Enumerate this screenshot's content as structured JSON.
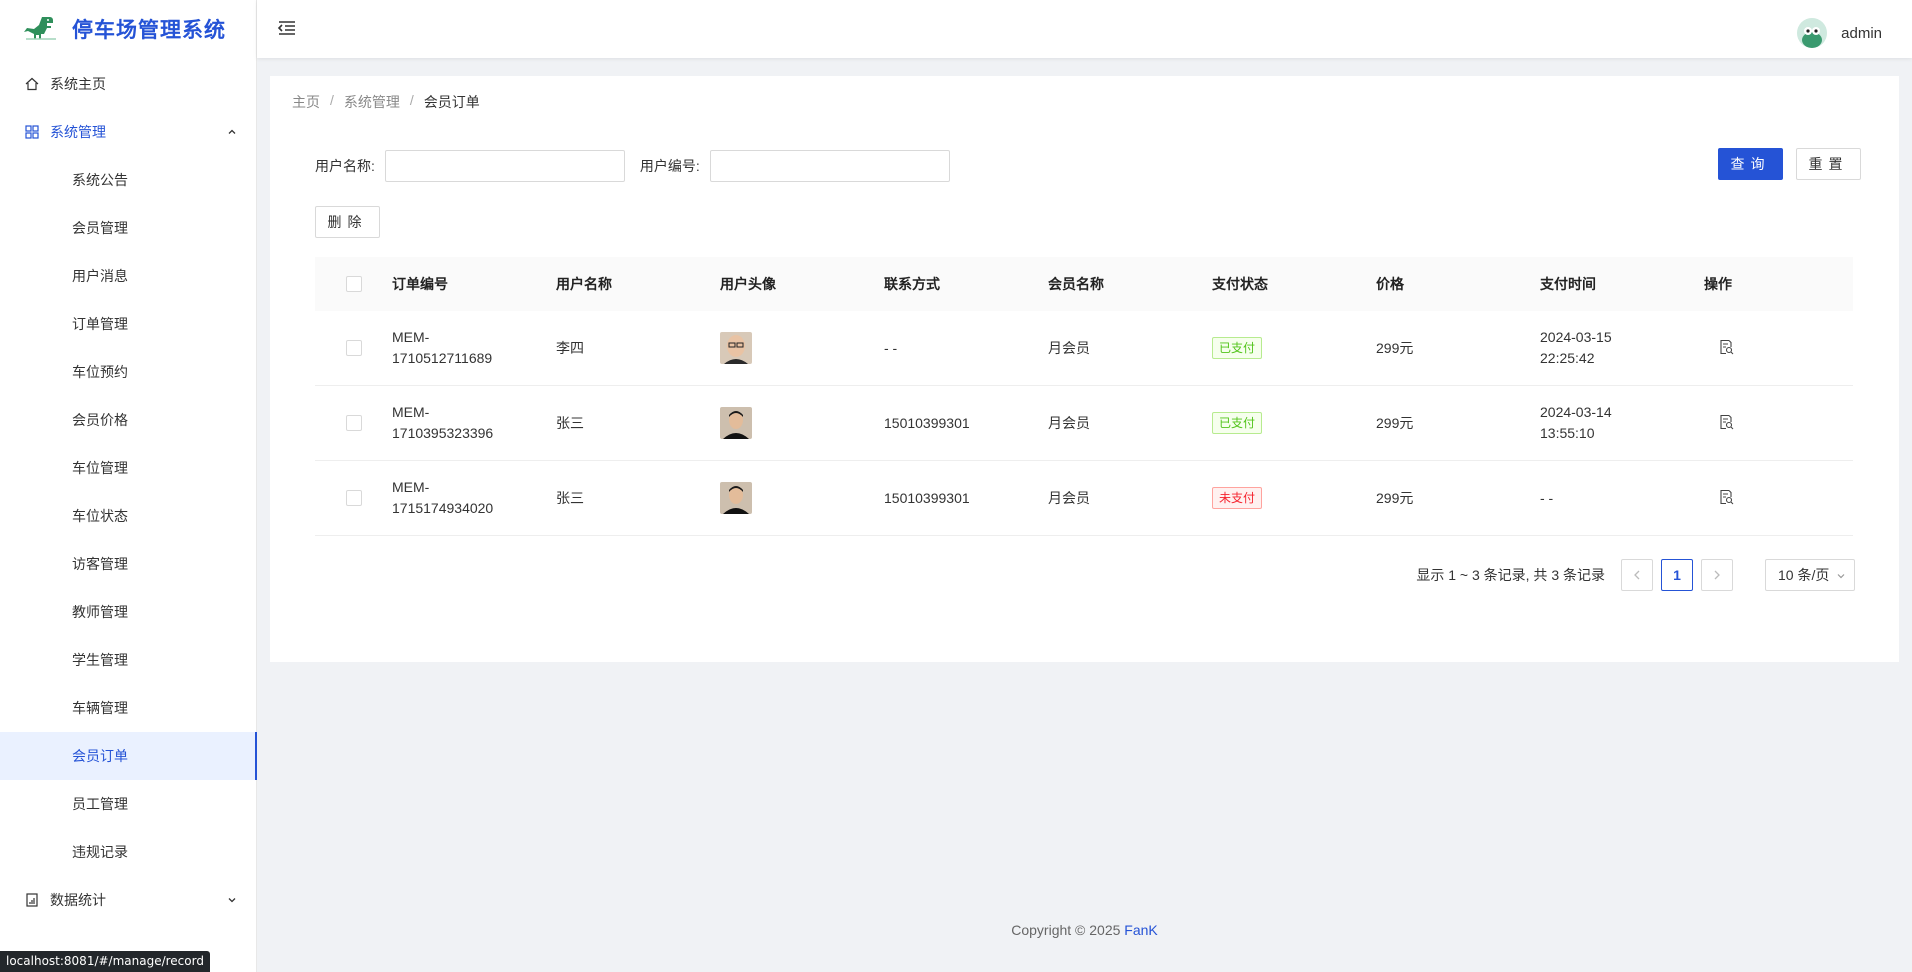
{
  "app": {
    "title": "停车场管理系统"
  },
  "sidebar": {
    "home": "系统主页",
    "system_group": "系统管理",
    "sub_items": [
      "系统公告",
      "会员管理",
      "用户消息",
      "订单管理",
      "车位预约",
      "会员价格",
      "车位管理",
      "车位状态",
      "访客管理",
      "教师管理",
      "学生管理",
      "车辆管理",
      "会员订单",
      "员工管理",
      "违规记录"
    ],
    "active_item": "会员订单",
    "stats_group": "数据统计"
  },
  "status_bar": {
    "url": "localhost:8081/#/manage/record"
  },
  "header": {
    "user_name": "admin"
  },
  "breadcrumb": {
    "home": "主页",
    "parent": "系统管理",
    "current": "会员订单"
  },
  "search": {
    "username_label": "用户名称:",
    "userno_label": "用户编号:",
    "username_value": "",
    "userno_value": "",
    "query_label": "查询",
    "reset_label": "重置"
  },
  "toolbar": {
    "delete_label": "删除"
  },
  "table": {
    "columns": [
      "订单编号",
      "用户名称",
      "用户头像",
      "联系方式",
      "会员名称",
      "支付状态",
      "价格",
      "支付时间",
      "操作"
    ],
    "rows": [
      {
        "order_no_1": "MEM-",
        "order_no_2": "1710512711689",
        "user_name": "李四",
        "contact": "- -",
        "member_name": "月会员",
        "pay_status": "已支付",
        "price": "299元",
        "pay_time_1": "2024-03-15",
        "pay_time_2": "22:25:42"
      },
      {
        "order_no_1": "MEM-",
        "order_no_2": "1710395323396",
        "user_name": "张三",
        "contact": "15010399301",
        "member_name": "月会员",
        "pay_status": "已支付",
        "price": "299元",
        "pay_time_1": "2024-03-14",
        "pay_time_2": "13:55:10"
      },
      {
        "order_no_1": "MEM-",
        "order_no_2": "1715174934020",
        "user_name": "张三",
        "contact": "15010399301",
        "member_name": "月会员",
        "pay_status": "未支付",
        "price": "299元",
        "pay_time_1": "- -",
        "pay_time_2": ""
      }
    ]
  },
  "pagination": {
    "total_text": "显示 1 ~ 3 条记录, 共 3 条记录",
    "current_page": "1",
    "page_size": "10 条/页"
  },
  "footer": {
    "copyright": "Copyright © 2025",
    "brand": "FanK"
  },
  "colors": {
    "primary": "#2553d6",
    "paid": "#52c41a",
    "unpaid": "#f5222d"
  }
}
